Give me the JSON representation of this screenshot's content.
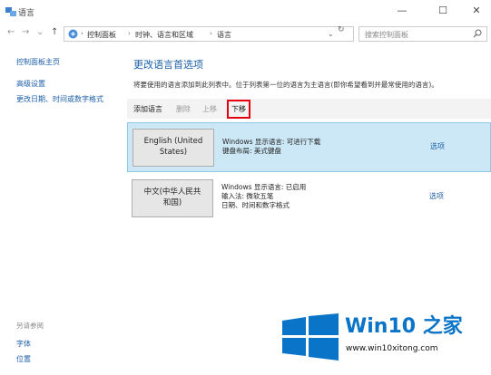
{
  "window": {
    "title": "语言",
    "controls": {
      "minimize": "—",
      "maximize": "☐",
      "close": "✕"
    }
  },
  "address_bar": {
    "nav": {
      "back": "←",
      "forward": "→",
      "dropdown": "⌄",
      "up": "↑"
    },
    "breadcrumbs": [
      "控制面板",
      "时钟、语言和区域",
      "语言"
    ],
    "separator": "›",
    "refresh": "↻",
    "search_placeholder": "搜索控制面板"
  },
  "sidebar": {
    "items": [
      "控制面板主页",
      "高级设置",
      "更改日期、时间或数字格式"
    ],
    "see_also_heading": "另请参阅",
    "see_also": [
      "字体",
      "位置"
    ]
  },
  "main": {
    "heading": "更改语言首选项",
    "description": "将要使用的语言添加到此列表中。位于列表第一位的语言为主语言(即你希望看到并最常使用的语言)。",
    "toolbar": {
      "add": "添加语言",
      "remove": "删除",
      "move_up": "上移",
      "move_down": "下移"
    },
    "languages": [
      {
        "name_lines": [
          "English (United",
          "States)"
        ],
        "info": [
          "Windows 显示语言: 可进行下载",
          "键盘布局: 美式键盘"
        ],
        "options": "选项",
        "selected": true
      },
      {
        "name_lines": [
          "中文(中华人民共",
          "和国)"
        ],
        "info": [
          "Windows 显示语言: 已启用",
          "输入法: 微软五笔",
          "日期、时间和数字格式"
        ],
        "options": "选项",
        "selected": false
      }
    ]
  },
  "watermark": {
    "title": "Win10 之家",
    "url": "www.win10xitong.com",
    "color": "#0a74c9"
  }
}
